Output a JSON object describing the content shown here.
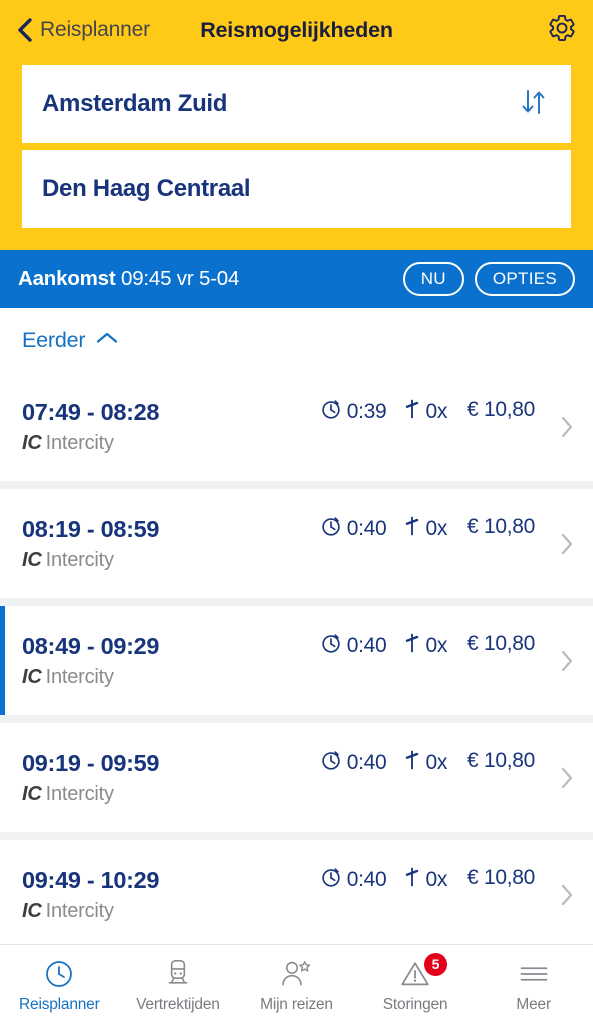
{
  "header": {
    "back_label": "Reisplanner",
    "title": "Reismogelijkheden",
    "gear_icon": "gear-icon",
    "back_icon": "chevron-left-icon",
    "yellow": "#FFC917",
    "navy": "#18347b"
  },
  "search": {
    "origin": "Amsterdam Zuid",
    "destination": "Den Haag Centraal",
    "swap_icon": "swap-vertical-icon"
  },
  "filterbar": {
    "arrival_prefix": "Aankomst",
    "arrival_value": "09:45 vr 5-04",
    "now_label": "NU",
    "options_label": "OPTIES",
    "blue": "#0A71CE"
  },
  "earlier": {
    "label": "Eerder",
    "icon": "chevron-up-icon"
  },
  "journeys": [
    {
      "times": "07:49 - 08:28",
      "type_code": "IC",
      "type_label": "Intercity",
      "duration": "0:39",
      "transfers": "0x",
      "price": "€ 10,80",
      "selected": false
    },
    {
      "times": "08:19 - 08:59",
      "type_code": "IC",
      "type_label": "Intercity",
      "duration": "0:40",
      "transfers": "0x",
      "price": "€ 10,80",
      "selected": false
    },
    {
      "times": "08:49 - 09:29",
      "type_code": "IC",
      "type_label": "Intercity",
      "duration": "0:40",
      "transfers": "0x",
      "price": "€ 10,80",
      "selected": true
    },
    {
      "times": "09:19 - 09:59",
      "type_code": "IC",
      "type_label": "Intercity",
      "duration": "0:40",
      "transfers": "0x",
      "price": "€ 10,80",
      "selected": false
    },
    {
      "times": "09:49 - 10:29",
      "type_code": "IC",
      "type_label": "Intercity",
      "duration": "0:40",
      "transfers": "0x",
      "price": "€ 10,80",
      "selected": false
    }
  ],
  "bottomnav": {
    "items": [
      {
        "label": "Reisplanner",
        "icon": "clock-icon",
        "active": true,
        "badge": null
      },
      {
        "label": "Vertrektijden",
        "icon": "train-icon",
        "active": false,
        "badge": null
      },
      {
        "label": "Mijn reizen",
        "icon": "person-star-icon",
        "active": false,
        "badge": null
      },
      {
        "label": "Storingen",
        "icon": "warning-triangle-icon",
        "active": false,
        "badge": "5"
      },
      {
        "label": "Meer",
        "icon": "hamburger-icon",
        "active": false,
        "badge": null
      }
    ]
  }
}
